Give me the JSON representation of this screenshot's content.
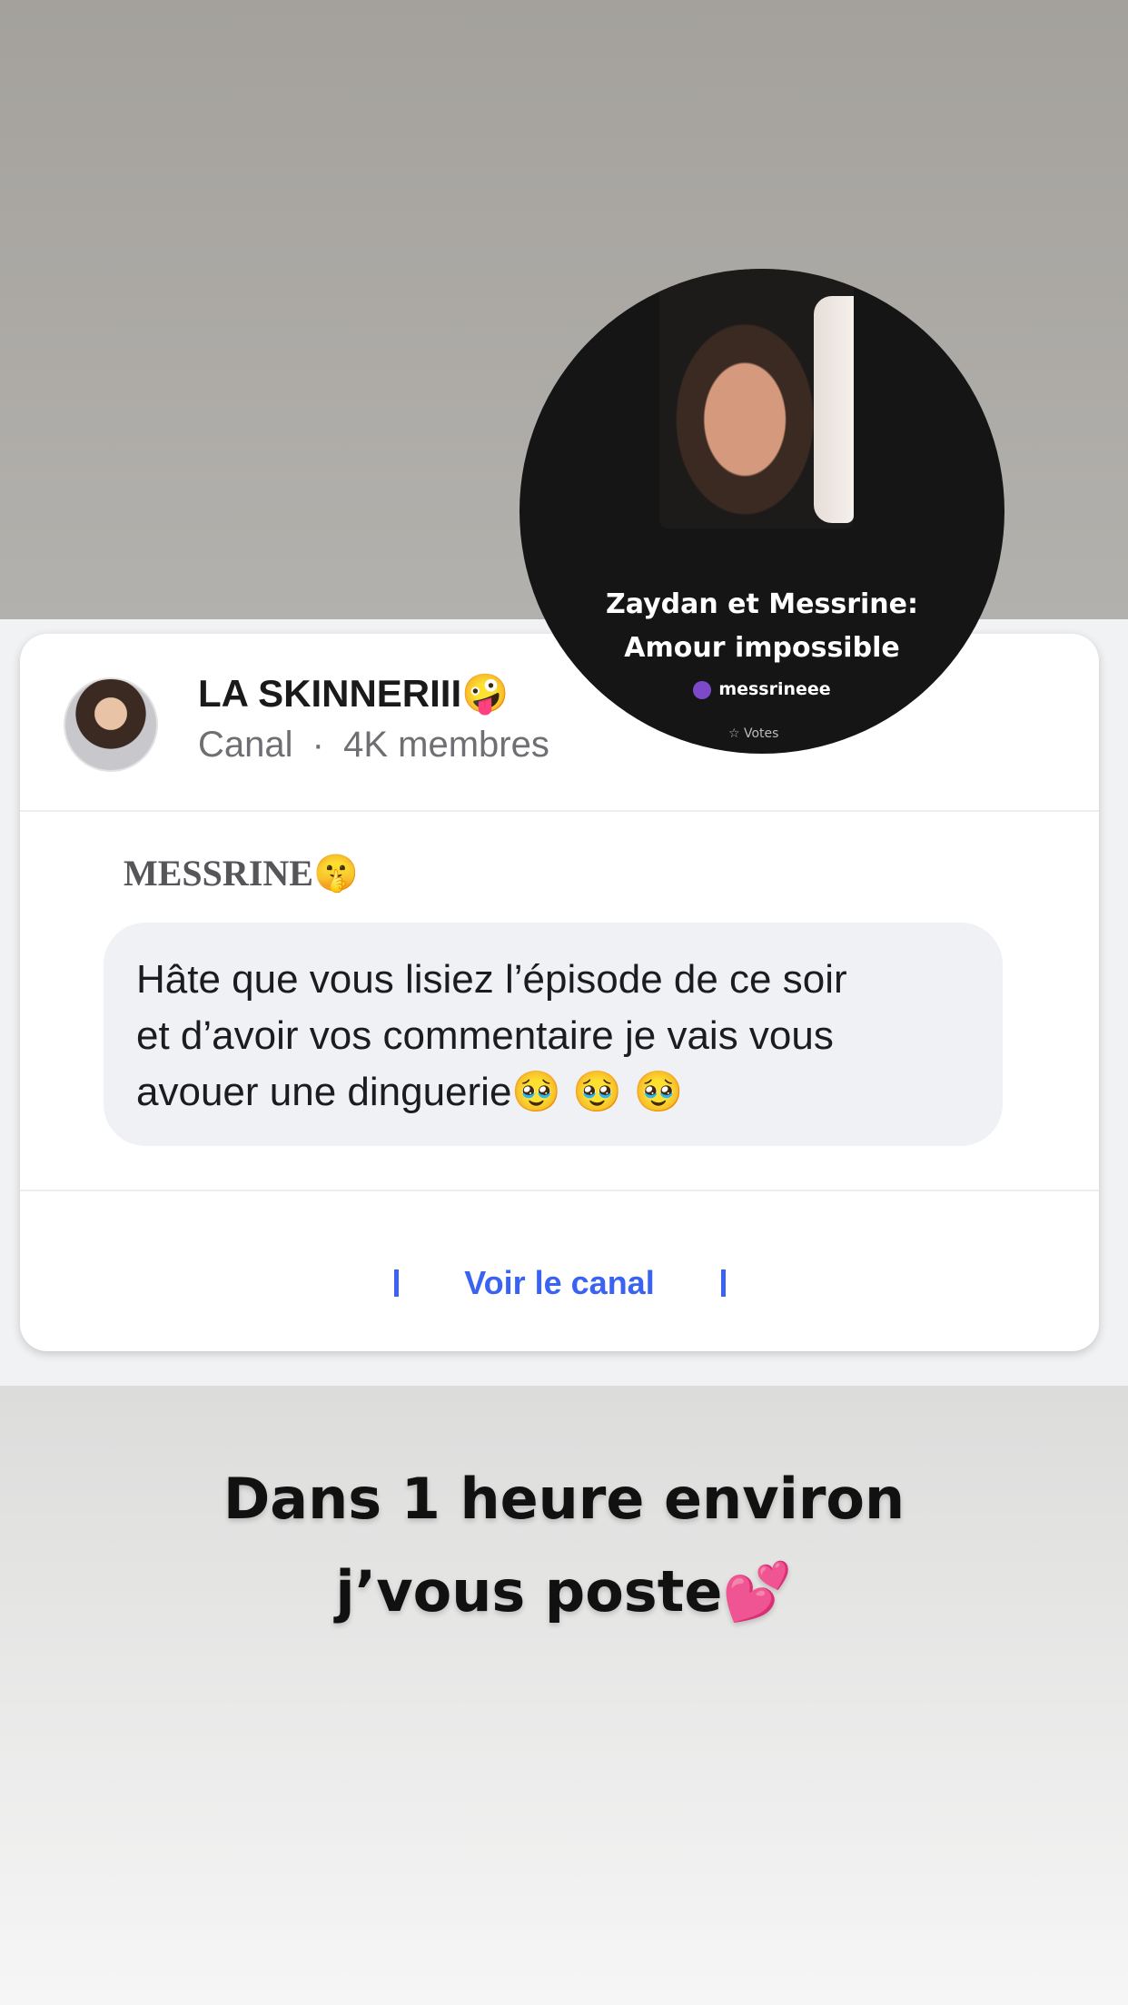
{
  "channel": {
    "name": "LA SKINNERIII🤪",
    "type": "Canal",
    "separator": "·",
    "members": "4K membres"
  },
  "message": {
    "sender": "MESSRINE🤫",
    "text": "Hâte que vous lisiez l’épisode de ce soir\net d’avoir vos commentaire je vais vous\navouer une dinguerie🥹 🥹 🥹"
  },
  "cta": {
    "label": "Voir le canal"
  },
  "story_cover": {
    "title": "Zaydan et Messrine:\nAmour impossible",
    "author": "messrineee",
    "votes_label": "☆ Votes"
  },
  "caption": "Dans 1 heure environ\nj’vous poste💕",
  "colors": {
    "accent": "#3b63f2",
    "card": "#ffffff",
    "bubble": "#eff1f5"
  }
}
